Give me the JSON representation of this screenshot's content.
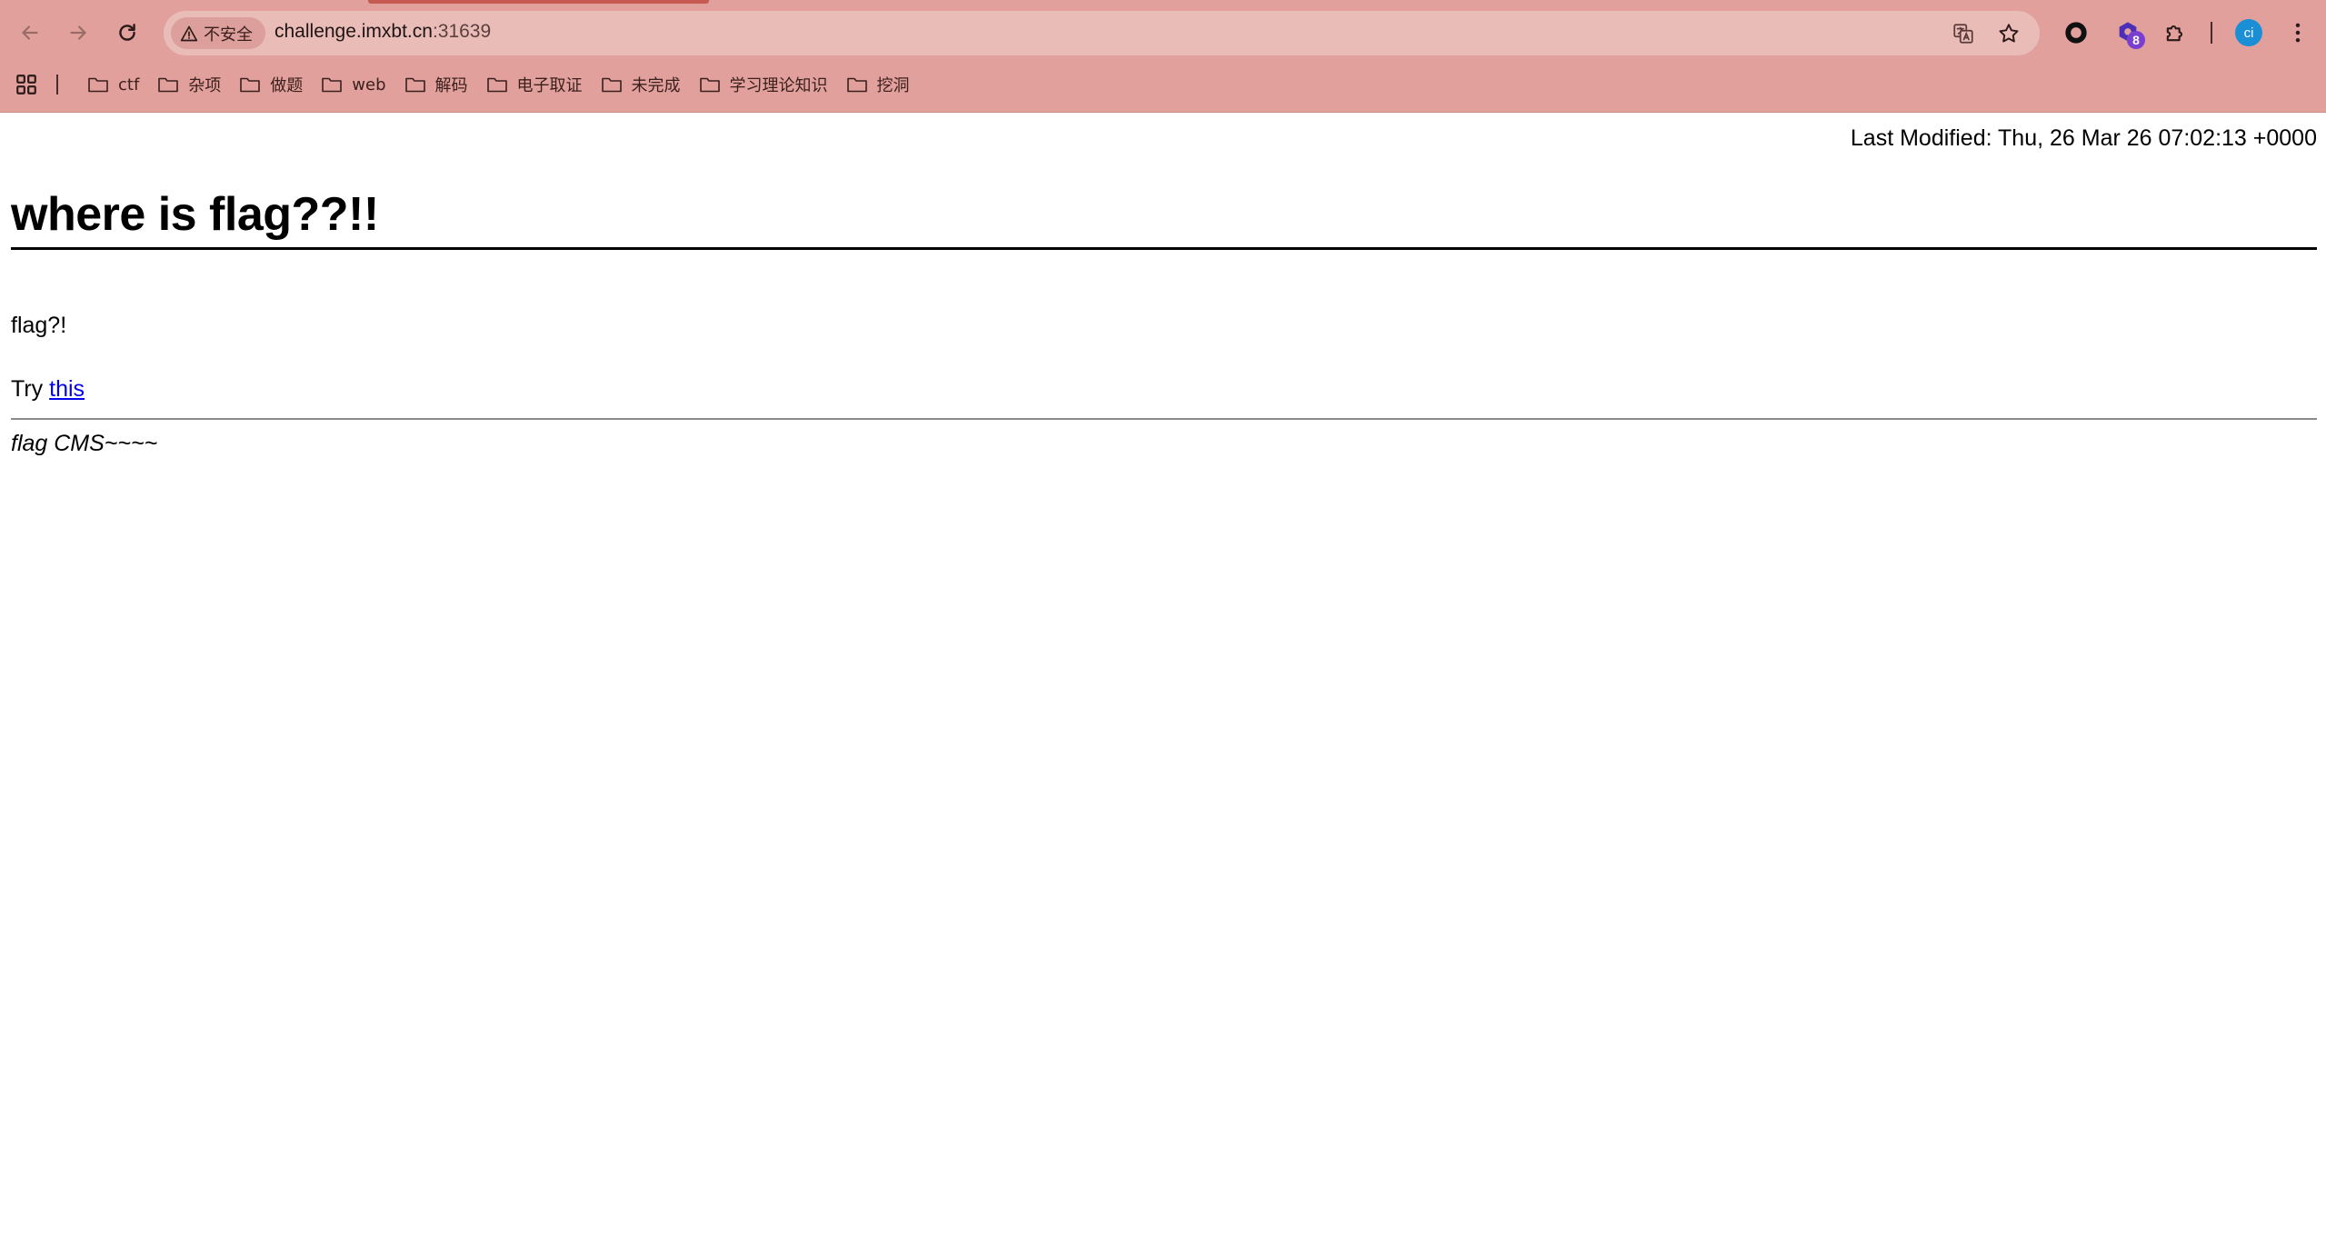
{
  "browser": {
    "security_label": "不安全",
    "url_host": "challenge.imxbt.cn",
    "url_port": ":31639",
    "extension_badge": "8",
    "profile_initials": "ci",
    "theme_color": "#e1a09b"
  },
  "bookmarks": [
    {
      "label": "ctf"
    },
    {
      "label": "杂项"
    },
    {
      "label": "做题"
    },
    {
      "label": "web"
    },
    {
      "label": "解码"
    },
    {
      "label": "电子取证"
    },
    {
      "label": "未完成"
    },
    {
      "label": "学习理论知识"
    },
    {
      "label": "挖洞"
    }
  ],
  "page": {
    "last_modified": "Last Modified: Thu, 26 Mar 26 07:02:13 +0000",
    "title": "where is flag??!!",
    "paragraph": "flag?!",
    "try_prefix": "Try ",
    "try_link": "this",
    "footer": "flag CMS~~~~",
    "link_color": "#0000ee"
  }
}
